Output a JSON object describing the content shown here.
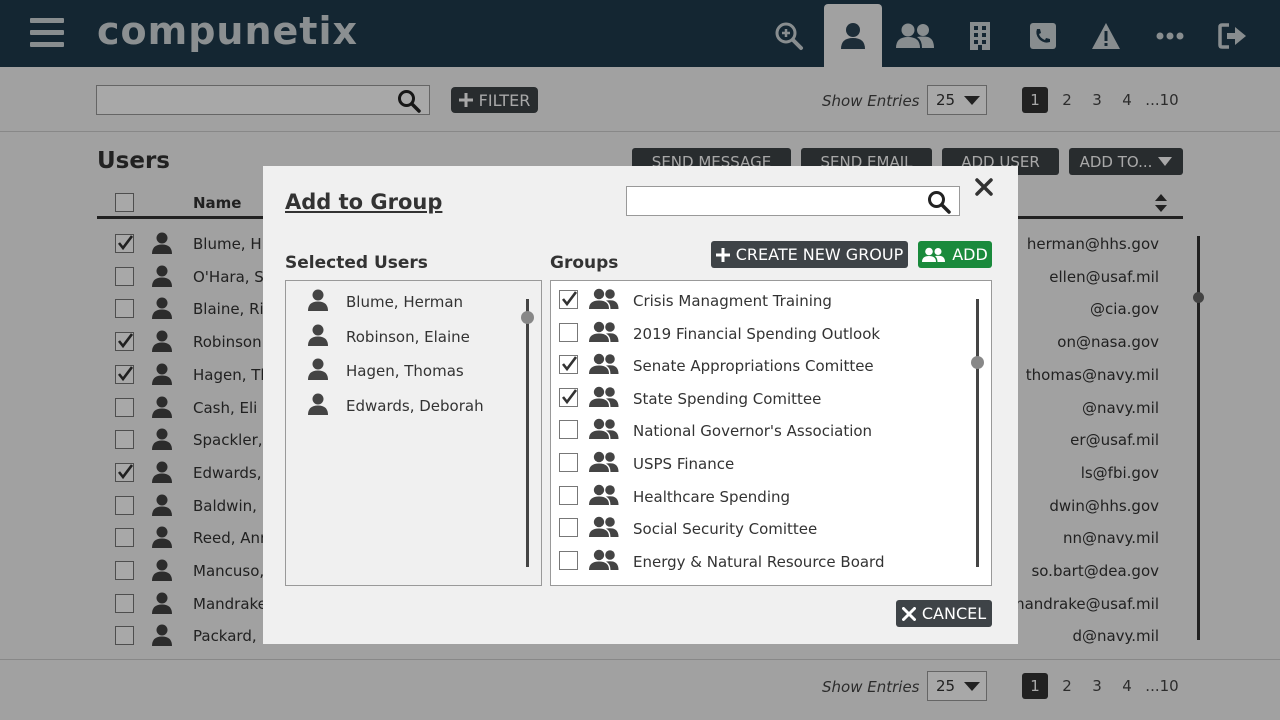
{
  "app": {
    "logo": "compunetix"
  },
  "toolbar": {
    "filter_label": "FILTER",
    "show_entries_label": "Show Entries",
    "entries_value": "25",
    "search_value": ""
  },
  "pagination": {
    "pages": [
      "1",
      "2",
      "3",
      "4",
      "...10"
    ],
    "current": "1"
  },
  "users": {
    "title": "Users",
    "actions": {
      "send_message": "SEND MESSAGE",
      "send_email": "SEND EMAIL",
      "add_user": "ADD USER",
      "add_to": "ADD TO..."
    },
    "columns": {
      "name": "Name"
    },
    "rows": [
      {
        "name": "Blume, H",
        "email": "herman@hhs.gov",
        "checked": true
      },
      {
        "name": "O'Hara, S",
        "email": "ellen@usaf.mil",
        "checked": false
      },
      {
        "name": "Blaine, Ri",
        "email": "@cia.gov",
        "checked": false
      },
      {
        "name": "Robinson",
        "email": "on@nasa.gov",
        "checked": true
      },
      {
        "name": "Hagen, Th",
        "email": "thomas@navy.mil",
        "checked": true
      },
      {
        "name": "Cash, Eli",
        "email": "@navy.mil",
        "checked": false
      },
      {
        "name": "Spackler,",
        "email": "er@usaf.mil",
        "checked": false
      },
      {
        "name": "Edwards,",
        "email": "ls@fbi.gov",
        "checked": true
      },
      {
        "name": "Baldwin,",
        "email": "dwin@hhs.gov",
        "checked": false
      },
      {
        "name": "Reed, Ann",
        "email": "nn@navy.mil",
        "checked": false
      },
      {
        "name": "Mancuso,",
        "email": "so.bart@dea.gov",
        "checked": false
      },
      {
        "name": "Mandrake",
        "email": "mandrake@usaf.mil",
        "checked": false
      },
      {
        "name": "Packard,",
        "email": "d@navy.mil",
        "checked": false
      }
    ]
  },
  "modal": {
    "title": "Add to Group",
    "search_value": "",
    "selected_users_label": "Selected Users",
    "groups_label": "Groups",
    "create_group_label": "CREATE NEW GROUP",
    "add_label": "ADD",
    "cancel_label": "CANCEL",
    "selected_users": [
      "Blume, Herman",
      "Robinson, Elaine",
      "Hagen, Thomas",
      "Edwards, Deborah"
    ],
    "groups": [
      {
        "name": "Crisis Managment Training",
        "checked": true
      },
      {
        "name": "2019 Financial Spending Outlook",
        "checked": false
      },
      {
        "name": "Senate Appropriations Comittee",
        "checked": true
      },
      {
        "name": "State Spending Comittee",
        "checked": true
      },
      {
        "name": "National Governor's Association",
        "checked": false
      },
      {
        "name": "USPS Finance",
        "checked": false
      },
      {
        "name": "Healthcare Spending",
        "checked": false
      },
      {
        "name": "Social Security Comittee",
        "checked": false
      },
      {
        "name": "Energy & Natural Resource Board",
        "checked": false
      }
    ]
  },
  "colors": {
    "header": "#1f3b4d",
    "dark_button": "#3e4347",
    "add_button": "#1a8a3c"
  }
}
